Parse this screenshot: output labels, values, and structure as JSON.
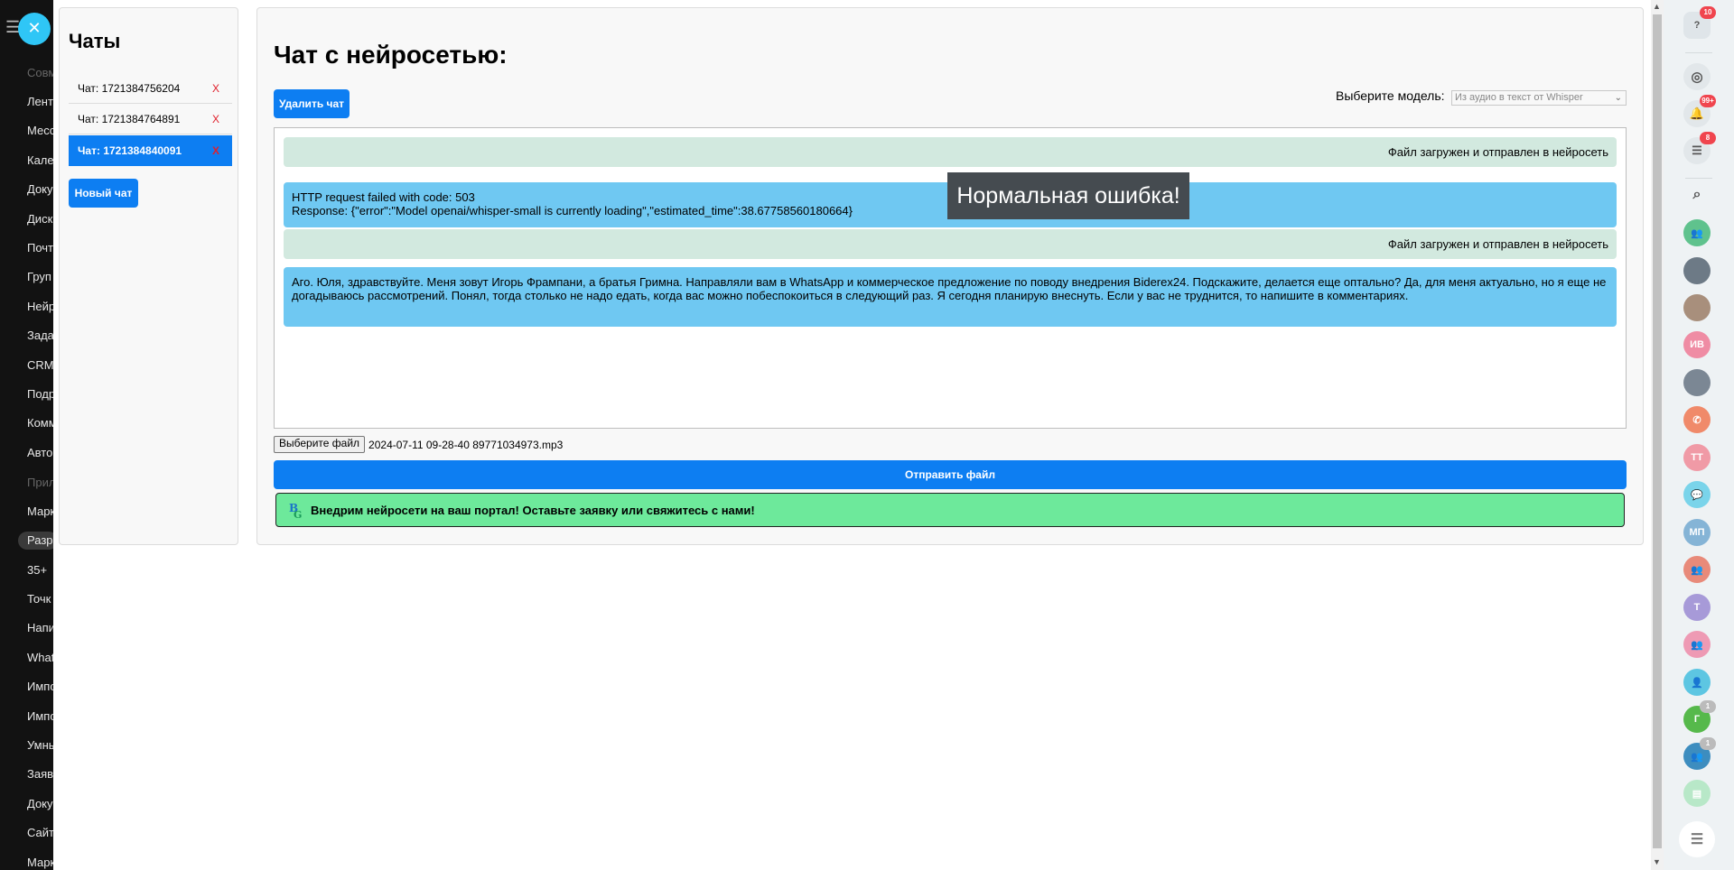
{
  "backdrop_menu": {
    "items": [
      "Совм",
      "Лент",
      "Месс",
      "Кале",
      "Доку",
      "Диск",
      "Почт",
      "Груп",
      "Нейр",
      "Зада",
      "CRM",
      "Подр",
      "Комм",
      "Авто",
      "Прил",
      "Марк",
      "Разр",
      "35+",
      "Точк",
      "Напи",
      "What",
      "Импо",
      "Импо",
      "Умны",
      "Заяв",
      "Доку",
      "Сайт",
      "Марк"
    ]
  },
  "chats_panel": {
    "title": "Чаты",
    "items": [
      {
        "label": "Чат: 1721384756204",
        "delete": "X"
      },
      {
        "label": "Чат: 1721384764891",
        "delete": "X"
      },
      {
        "label": "Чат: 1721384840091",
        "delete": "X"
      }
    ],
    "new_chat_label": "Новый чат"
  },
  "main": {
    "title": "Чат с нейросетью:",
    "delete_chat_label": "Удалить чат",
    "model_label": "Выберите модель:",
    "model_selected": "Из аудио в текст от Whisper",
    "messages": [
      {
        "type": "system",
        "lines": [
          "Файл загружен и отправлен в нейросеть"
        ]
      },
      {
        "type": "bot",
        "lines": [
          "HTTP request failed with code: 503",
          "Response: {\"error\":\"Model openai/whisper-small is currently loading\",\"estimated_time\":38.67758560180664}"
        ]
      },
      {
        "type": "system",
        "lines": [
          "Файл загружен и отправлен в нейросеть"
        ]
      },
      {
        "type": "bot",
        "lines": [
          "Аго. Юля, здравствуйте. Меня зовут Игорь Фрампани, а братья Гримна. Направляли вам в WhatsApp и коммерческое предложение по поводу внедрения Biderex24. Подскажите, делается еще оптально? Да, для меня актуально, но я еще не догадываюсь рассмотрений. Понял, тогда столько не надо едать, когда вас можно побеспокоиться в следующий раз. Я сегодня планирую внеснуть. Если у вас не труднится, то напишите в комментариях."
        ]
      }
    ],
    "tooltip": "Нормальная ошибка!",
    "file_button_label": "Выберите файл",
    "file_name": "2024-07-11 09-28-40 89771034973.mp3",
    "send_label": "Отправить файл",
    "promo_text": "Внедрим нейросети на ваш портал! Оставьте заявку или свяжитесь с нами!"
  },
  "right_bar": {
    "help_badge": "10",
    "notifications_badge": "99+",
    "messages_badge": "8",
    "avatars": [
      "ИВ",
      "ТТ",
      "МП",
      "Т",
      "Г"
    ],
    "avatar_badges": [
      "1",
      "1"
    ]
  },
  "colors": {
    "accent": "#0d7ef2",
    "system_msg": "#d2e9df",
    "bot_msg": "#6fc8f2",
    "promo": "#6de99b",
    "delete_x": "#e0202c"
  }
}
